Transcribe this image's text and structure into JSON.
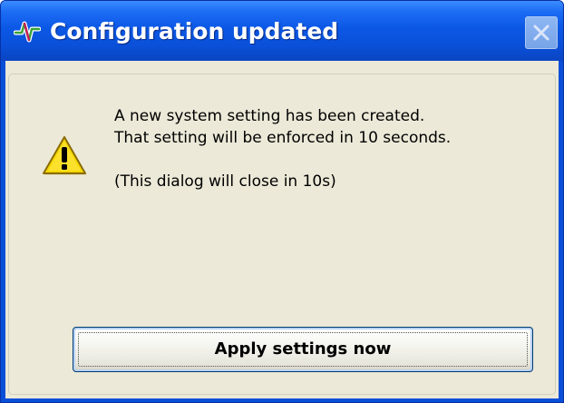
{
  "window": {
    "title": "Configuration updated",
    "app_icon": "activity-pulse-icon",
    "close_icon": "close-icon"
  },
  "message": {
    "icon": "warning-icon",
    "line1": "A new system setting has been created.",
    "line2": "That setting will be enforced in 10 seconds.",
    "countdown": "(This dialog will close in 10s)"
  },
  "actions": {
    "apply_label": "Apply settings now"
  },
  "colors": {
    "titlebar": "#0a50d8",
    "client_background": "#ece9d8",
    "warning_yellow": "#f5d800"
  }
}
